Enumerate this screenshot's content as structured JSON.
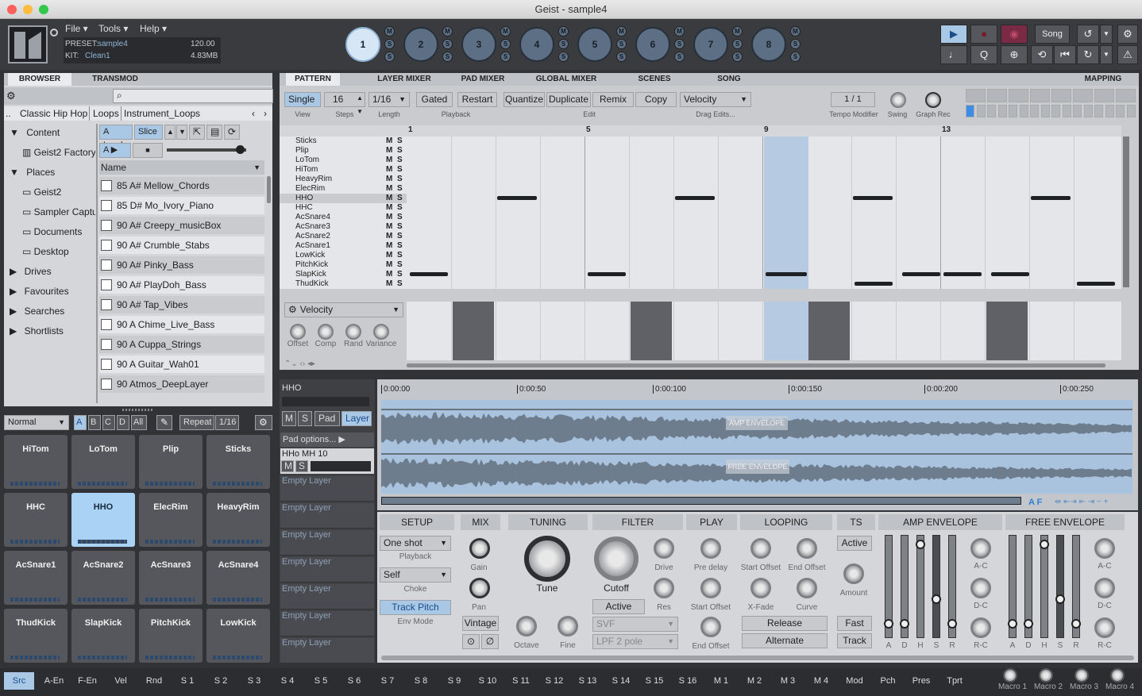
{
  "window": {
    "title": "Geist - sample4"
  },
  "menu": {
    "file": "File ▾",
    "tools": "Tools ▾",
    "help": "Help ▾"
  },
  "preset": {
    "preset_label": "PRESET:",
    "preset_value": "sample4",
    "kit_label": "KIT:",
    "kit_value": "Clean1",
    "tempo": "120.00",
    "size": "4.83MB"
  },
  "pads_top": [
    "1",
    "2",
    "3",
    "4",
    "5",
    "6",
    "7",
    "8"
  ],
  "msc": [
    "M",
    "S",
    "S"
  ],
  "transport": {
    "song": "Song",
    "q": "Q"
  },
  "browser": {
    "tab_browser": "BROWSER",
    "tab_transmod": "TRANSMOD",
    "breadcrumb": [
      "..",
      "Classic Hip Hop",
      "Loops",
      "Instrument_Loops"
    ],
    "load": "A Load",
    "slice": "Slice",
    "play_a": "A ▶",
    "name_header": "Name",
    "tree": {
      "content": "Content",
      "factory": "Geist2 Factory",
      "places": "Places",
      "geist2": "Geist2",
      "sampler": "Sampler Capture",
      "documents": "Documents",
      "desktop": "Desktop",
      "drives": "Drives",
      "favourites": "Favourites",
      "searches": "Searches",
      "shortlists": "Shortlists"
    },
    "files": [
      "85 A# Mellow_Chords",
      "85 D# Mo_Ivory_Piano",
      "90 A# Creepy_musicBox",
      "90 A# Crumble_Stabs",
      "90 A# Pinky_Bass",
      "90 A# PlayDoh_Bass",
      "90 A# Tap_Vibes",
      "90 A Chime_Live_Bass",
      "90 A Cuppa_Strings",
      "90 A Guitar_Wah01",
      "90 Atmos_DeepLayer"
    ]
  },
  "padbank": {
    "mode": "Normal",
    "banks": [
      "A",
      "B",
      "C",
      "D",
      "All"
    ],
    "repeat": "Repeat",
    "repeat_val": "1/16",
    "pads": [
      "HiTom",
      "LoTom",
      "Plip",
      "Sticks",
      "HHC",
      "HHO",
      "ElecRim",
      "HeavyRim",
      "AcSnare1",
      "AcSnare2",
      "AcSnare3",
      "AcSnare4",
      "ThudKick",
      "SlapKick",
      "PitchKick",
      "LowKick"
    ]
  },
  "seq": {
    "tabs": [
      "PATTERN",
      "LAYER MIXER",
      "PAD MIXER",
      "GLOBAL MIXER",
      "SCENES",
      "SONG",
      "MAPPING"
    ],
    "single": "Single",
    "view": "View",
    "steps_val": "16",
    "steps": "Steps",
    "length_val": "1/16",
    "length": "Length",
    "gated": "Gated",
    "restart": "Restart",
    "playback": "Playback",
    "quantize": "Quantize",
    "duplicate": "Duplicate",
    "remix": "Remix",
    "copy": "Copy",
    "edit": "Edit",
    "velocity": "Velocity",
    "drag_edits": "Drag Edits...",
    "tempo_mod_val": "1 / 1",
    "tempo_mod": "Tempo Modifier",
    "swing": "Swing",
    "graph_rec": "Graph Rec",
    "bars": [
      "1",
      "5",
      "9",
      "13"
    ],
    "rows": [
      "Sticks",
      "Plip",
      "LoTom",
      "HiTom",
      "HeavyRim",
      "ElecRim",
      "HHO",
      "HHC",
      "AcSnare4",
      "AcSnare3",
      "AcSnare2",
      "AcSnare1",
      "LowKick",
      "PitchKick",
      "SlapKick",
      "ThudKick"
    ],
    "velocity_label": "Velocity",
    "knobs": [
      "Offset",
      "Comp",
      "Rand",
      "Variance"
    ]
  },
  "layers": {
    "pad_name": "HHO",
    "m": "M",
    "s": "S",
    "pad": "Pad",
    "layer": "Layer",
    "pad_options": "Pad options... ▶",
    "layer1": "HHo MH 10",
    "empty": "Empty Layer"
  },
  "wave": {
    "times": [
      "0:00:00",
      "0:00:50",
      "0:00:100",
      "0:00:150",
      "0:00:200",
      "0:00:250"
    ],
    "amp_env": "AMP ENVELOPE",
    "free_env": "FREE ENVELOPE",
    "af": "A F"
  },
  "controls": {
    "setup": "SETUP",
    "mix": "MIX",
    "tuning": "TUNING",
    "filter": "FILTER",
    "play": "PLAY",
    "looping": "LOOPING",
    "ts": "TS",
    "amp_envelope": "AMP ENVELOPE",
    "free_envelope": "FREE ENVELOPE",
    "oneshot": "One shot",
    "playback": "Playback",
    "self": "Self",
    "choke": "Choke",
    "track_pitch": "Track Pitch",
    "env_mode": "Env Mode",
    "gain": "Gain",
    "pan": "Pan",
    "vintage": "Vintage",
    "tune": "Tune",
    "octave": "Octave",
    "fine": "Fine",
    "cutoff": "Cutoff",
    "drive": "Drive",
    "res": "Res",
    "active": "Active",
    "svf": "SVF",
    "lpf": "LPF 2 pole",
    "predelay": "Pre delay",
    "start_offset": "Start Offset",
    "end_offset": "End Offset",
    "lstart": "Start Offset",
    "lend": "End Offset",
    "xfade": "X-Fade",
    "curve": "Curve",
    "release": "Release",
    "alternate": "Alternate",
    "ts_active": "Active",
    "amount": "Amount",
    "fast": "Fast",
    "track": "Track",
    "env_sliders": [
      "A",
      "D",
      "H",
      "S",
      "R"
    ],
    "ac": "A-C",
    "dc": "D-C",
    "rc": "R-C"
  },
  "bottom": {
    "tabs": [
      "Src",
      "A-En",
      "F-En",
      "Vel",
      "Rnd",
      "S 1",
      "S 2",
      "S 3",
      "S 4",
      "S 5",
      "S 6",
      "S 7",
      "S 8",
      "S 9",
      "S 10",
      "S 11",
      "S 12",
      "S 13",
      "S 14",
      "S 15",
      "S 16",
      "M 1",
      "M 2",
      "M 3",
      "M 4",
      "Mod",
      "Pch",
      "Pres",
      "Tprt"
    ],
    "macros": [
      "Macro 1",
      "Macro 2",
      "Macro 3",
      "Macro 4"
    ]
  }
}
